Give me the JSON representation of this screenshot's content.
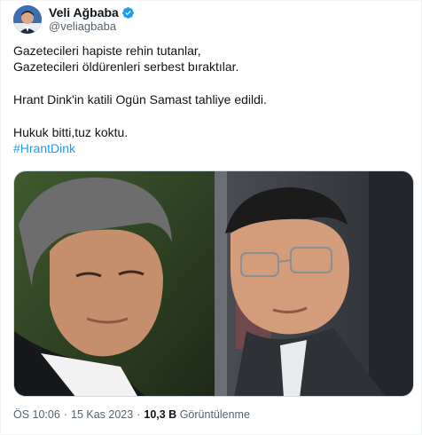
{
  "author": {
    "display_name": "Veli Ağbaba",
    "handle": "@veliagbaba",
    "verified_icon": "verified-badge-icon",
    "badge_color": "#1d9bf0"
  },
  "tweet": {
    "lines": [
      "Gazetecileri hapiste rehin tutanlar,",
      "Gazetecileri öldürenleri serbest bıraktılar.",
      "Hrant Dink'in katili Ogün Samast tahliye edildi.",
      "Hukuk bitti,tuz koktu."
    ],
    "hashtag": "#HrantDink",
    "hashtag_color": "#1d9bf0"
  },
  "meta": {
    "time": "ÖS 10:06",
    "date": "15 Kas 2023",
    "views_count": "10,3 B",
    "views_label": "Görüntülenme",
    "separator": "·"
  }
}
